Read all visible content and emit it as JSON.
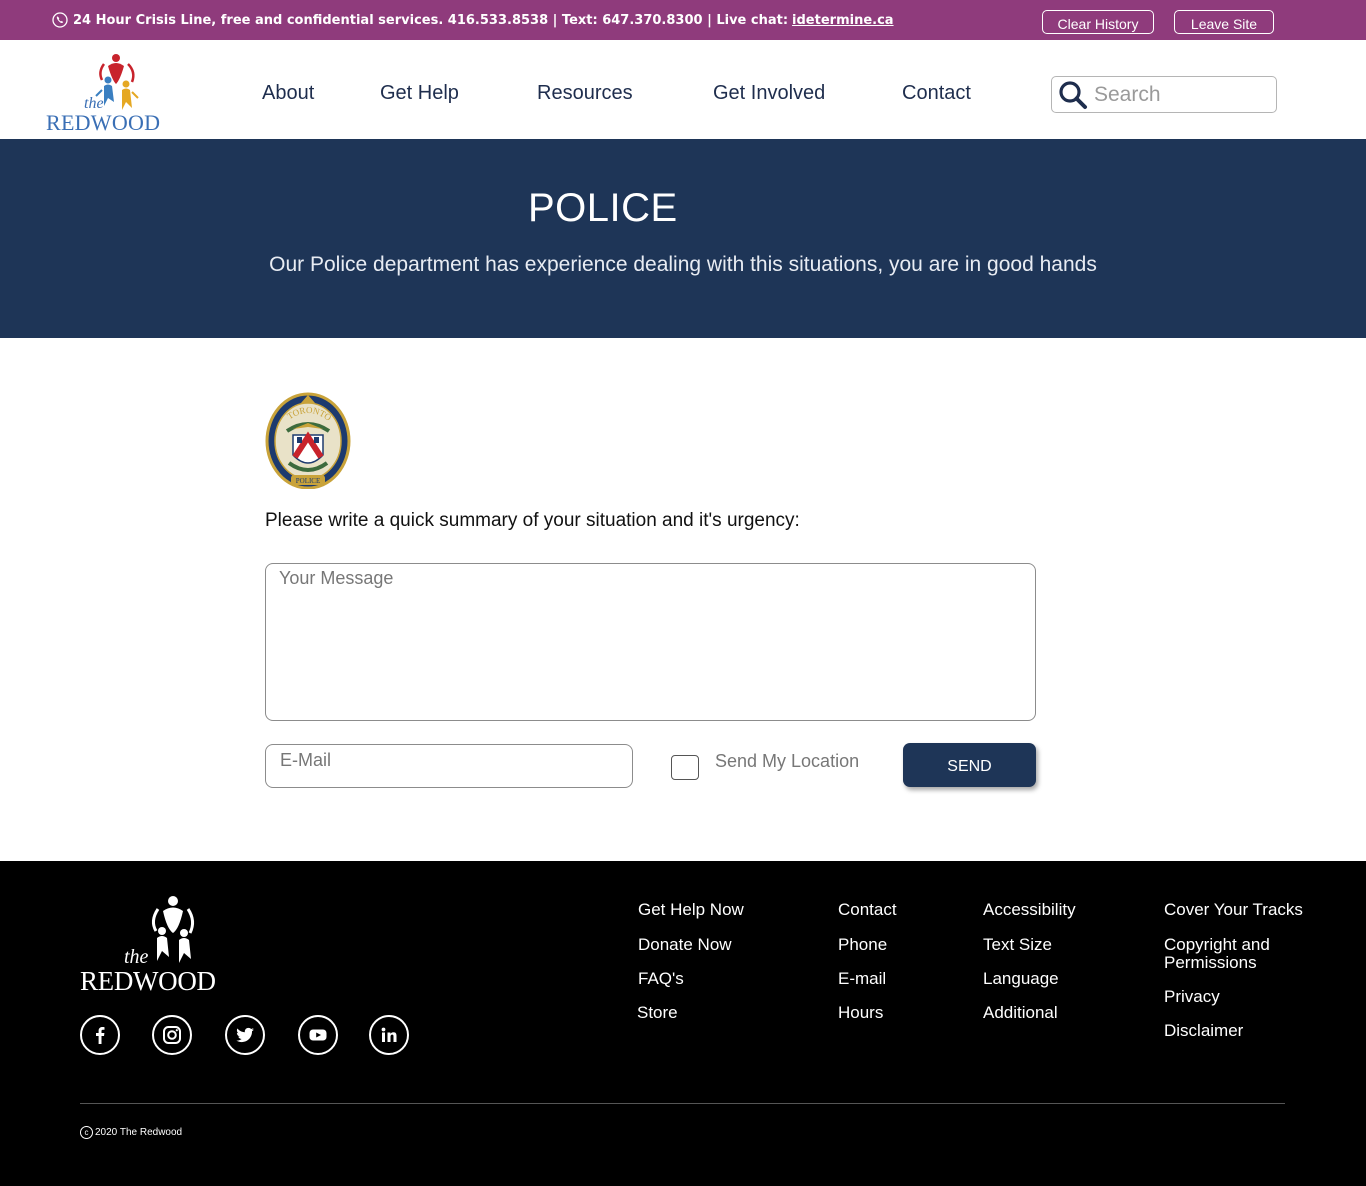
{
  "crisis_bar": {
    "text": "24 Hour Crisis Line, free and confidential services. 416.533.8538 | Text: 647.370.8300 | Live chat:",
    "link": "idetermine.ca",
    "clear_history": "Clear History",
    "leave_site": "Leave Site",
    "color": "#8f3b7c"
  },
  "header": {
    "logo_text": {
      "the": "the",
      "name": "REDWOOD"
    },
    "nav": [
      "About",
      "Get Help",
      "Resources",
      "Get Involved",
      "Contact"
    ],
    "search_placeholder": "Search"
  },
  "hero": {
    "title": "POLICE",
    "subtitle": "Our Police department has experience dealing with this situations, you are in good hands",
    "color": "#1e3557"
  },
  "form": {
    "badge_text": {
      "top": "TORONTO",
      "bottom": "POLICE"
    },
    "prompt": "Please write a quick summary of your situation and it's urgency:",
    "message_placeholder": "Your Message",
    "email_placeholder": "E-Mail",
    "location_label": "Send My Location",
    "location_checked": false,
    "send_label": "SEND"
  },
  "footer": {
    "logo_text": {
      "the": "the",
      "name": "REDWOOD"
    },
    "social": [
      "facebook-icon",
      "instagram-icon",
      "twitter-icon",
      "youtube-icon",
      "linkedin-icon"
    ],
    "columns": [
      [
        "Get Help Now",
        "Donate Now",
        "FAQ's",
        "Store"
      ],
      [
        "Contact",
        "Phone",
        "E-mail",
        "Hours"
      ],
      [
        "Accessibility",
        "Text Size",
        "Language",
        "Additional"
      ],
      [
        "Cover Your Tracks",
        "Copyright and Permissions",
        "Privacy",
        "Disclaimer"
      ]
    ],
    "copyright": "2020 The Redwood"
  }
}
